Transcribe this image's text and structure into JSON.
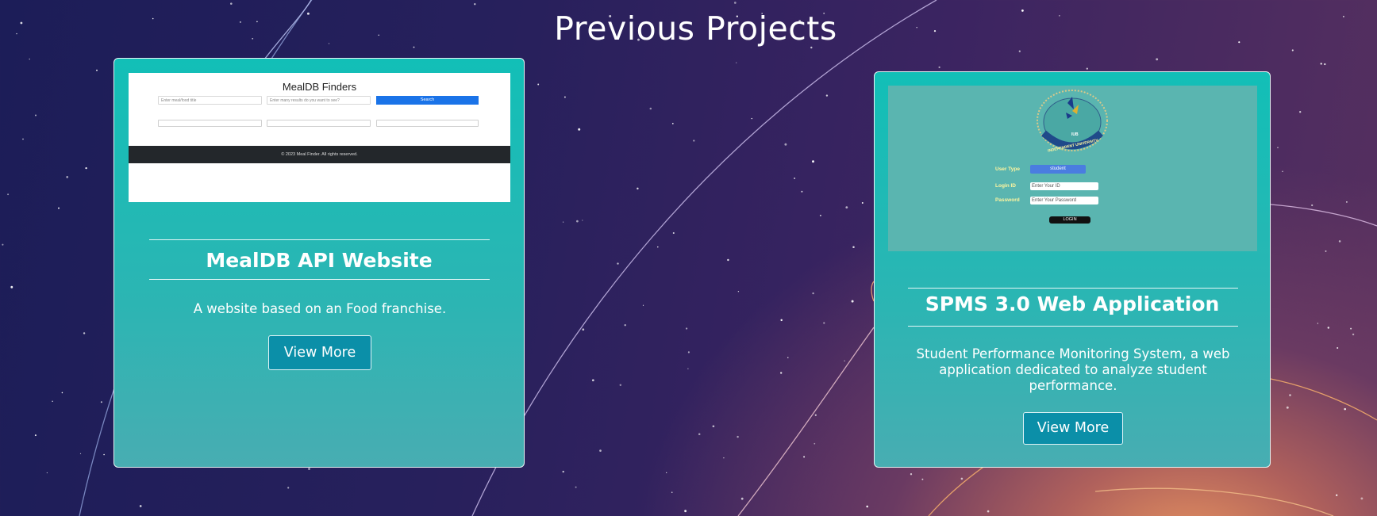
{
  "page": {
    "title": "Previous Projects",
    "colors": {
      "card_accent": "#12bfb7",
      "button": "#0b8fa8",
      "background_dark": "#1c1d58"
    }
  },
  "projects": [
    {
      "title": "MealDB API Website",
      "description": "A website based on an Food franchise.",
      "button_label": "View More",
      "thumbnail": {
        "site_title": "MealDB Finders",
        "input1_placeholder": "Enter meal/food title",
        "input2_placeholder": "Enter many results do you want to see?",
        "search_label": "Search",
        "footer_text": "© 2023 Meal Finder. All rights reserved."
      }
    },
    {
      "title": "SPMS 3.0 Web Application",
      "description": "Student Performance Monitoring System, a web application dedicated to analyze student performance.",
      "button_label": "View More",
      "thumbnail": {
        "logo_text": "INDEPENDENT UNIVERSITY",
        "logo_abbr": "IUB",
        "user_type_label": "User Type",
        "user_type_value": "student",
        "login_id_label": "Login ID",
        "login_id_placeholder": "Enter Your ID",
        "password_label": "Password",
        "password_placeholder": "Enter Your Password",
        "login_button": "LOGIN"
      }
    }
  ]
}
